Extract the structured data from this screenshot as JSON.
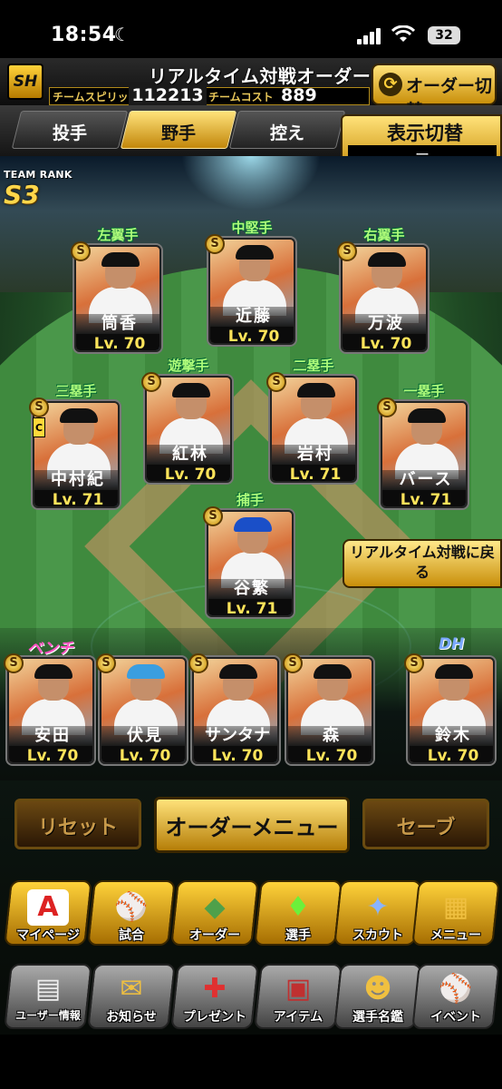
{
  "status": {
    "time": "18:54",
    "battery": "32"
  },
  "header": {
    "title": "リアルタイム対戦オーダー",
    "spirit_label": "チームスピリッツ",
    "spirit_value": "112213",
    "cost_label": "チームコスト",
    "cost_value": "889",
    "order_switch": "オーダー切替"
  },
  "tabs": [
    {
      "label": "投手",
      "active": false
    },
    {
      "label": "野手",
      "active": true
    },
    {
      "label": "控え",
      "active": false
    }
  ],
  "display_switch": {
    "label": "表示切替",
    "value": "ー"
  },
  "team_rank": {
    "label": "TEAM RANK",
    "value": "S3"
  },
  "lineup": [
    {
      "pos": "左翼手",
      "name": "筒香",
      "lv": "Lv. 70"
    },
    {
      "pos": "中堅手",
      "name": "近藤",
      "lv": "Lv. 70"
    },
    {
      "pos": "右翼手",
      "name": "万波",
      "lv": "Lv. 70"
    },
    {
      "pos": "遊撃手",
      "name": "紅林",
      "lv": "Lv. 70"
    },
    {
      "pos": "二塁手",
      "name": "岩村",
      "lv": "Lv. 71"
    },
    {
      "pos": "三塁手",
      "name": "中村紀",
      "lv": "Lv. 71"
    },
    {
      "pos": "一塁手",
      "name": "バース",
      "lv": "Lv. 71"
    },
    {
      "pos": "捕手",
      "name": "谷繁",
      "lv": "Lv. 71"
    }
  ],
  "back_button": "リアルタイム対戦に戻る",
  "bench_label": "ベンチ",
  "dh_label": "DH",
  "bench": [
    {
      "name": "安田",
      "lv": "Lv. 70"
    },
    {
      "name": "伏見",
      "lv": "Lv. 70"
    },
    {
      "name": "サンタナ",
      "lv": "Lv. 70"
    },
    {
      "name": "森",
      "lv": "Lv. 70"
    }
  ],
  "dh": {
    "name": "鈴木",
    "lv": "Lv. 70"
  },
  "actions": {
    "reset": "リセット",
    "order_menu": "オーダーメニュー",
    "save": "セーブ"
  },
  "nav_row1": [
    {
      "label": "マイページ",
      "icon": "A"
    },
    {
      "label": "試合",
      "icon": "⚾"
    },
    {
      "label": "オーダー",
      "icon": "◆"
    },
    {
      "label": "選手",
      "icon": "♦"
    },
    {
      "label": "スカウト",
      "icon": "✦"
    },
    {
      "label": "メニュー",
      "icon": "▦"
    }
  ],
  "nav_row2": [
    {
      "label": "ユーザー情報",
      "icon": "▤"
    },
    {
      "label": "お知らせ",
      "icon": "✉"
    },
    {
      "label": "プレゼント",
      "icon": "✚"
    },
    {
      "label": "アイテム",
      "icon": "▣"
    },
    {
      "label": "選手名鑑",
      "icon": "☻"
    },
    {
      "label": "イベント",
      "icon": "⚾"
    }
  ],
  "colors": {
    "gold": "#ffd23a",
    "level": "#ffe45a",
    "position": "#aefc7a",
    "bench": "#ff4fc3",
    "dh": "#7aa8ff"
  }
}
